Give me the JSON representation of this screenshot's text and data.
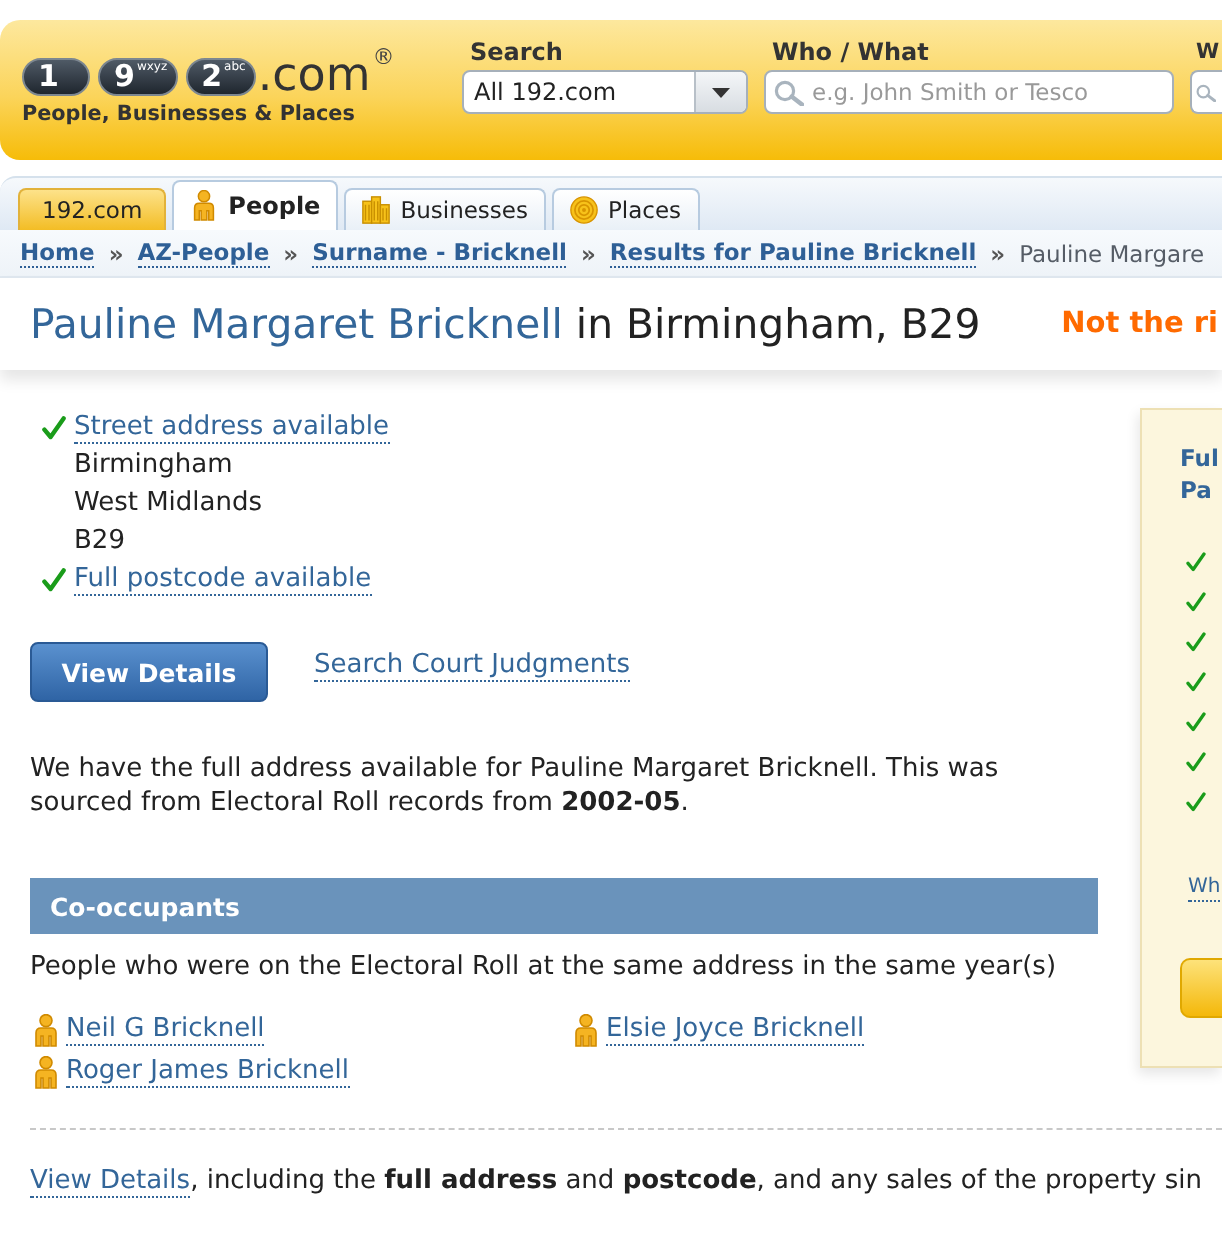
{
  "header": {
    "logo": {
      "keys": [
        {
          "digit": "1"
        },
        {
          "digit": "9",
          "letters": "wxyz"
        },
        {
          "digit": "2",
          "letters": "abc"
        }
      ],
      "domain": ".com",
      "registered": "®",
      "tagline": "People, Businesses & Places"
    },
    "search_fields": [
      {
        "kind": "select",
        "label": "Search",
        "value": "All 192.com"
      },
      {
        "kind": "text",
        "label": "Who / What",
        "placeholder": "e.g. John Smith or Tesco"
      },
      {
        "kind": "text",
        "label": "W"
      }
    ]
  },
  "tabs": [
    {
      "kind": "home",
      "label": "192.com",
      "selected": false
    },
    {
      "kind": "people",
      "label": "People",
      "selected": true
    },
    {
      "kind": "businesses",
      "label": "Businesses",
      "selected": false
    },
    {
      "kind": "places",
      "label": "Places",
      "selected": false
    }
  ],
  "breadcrumb": {
    "links": [
      {
        "label": "Home",
        "separator": "»"
      },
      {
        "label": "AZ-People",
        "separator": "»"
      },
      {
        "label": "Surname - Bricknell",
        "separator": "»"
      },
      {
        "label": "Results for Pauline Bricknell",
        "separator": "»"
      }
    ],
    "current": "Pauline Margare"
  },
  "title": {
    "name": "Pauline Margaret Bricknell",
    "location": "in Birmingham, B29",
    "notice": "Not the ri"
  },
  "address": [
    {
      "kind": "status",
      "text": "Street address available",
      "available": true
    },
    {
      "kind": "line",
      "text": "Birmingham"
    },
    {
      "kind": "line",
      "text": "West Midlands"
    },
    {
      "kind": "line",
      "text": "B29"
    },
    {
      "kind": "status",
      "text": "Full postcode available",
      "available": true
    }
  ],
  "actions": {
    "button": "View Details",
    "link": "Search Court Judgments"
  },
  "summary": "We have the full address available for Pauline Margaret Bricknell. This was sourced from Electoral Roll records from **2002-05**.",
  "co_occupants": {
    "heading": "Co-occupants",
    "intro": "People who were on the Electoral Roll at the same address in the same year(s)",
    "people": [
      "Neil G Bricknell",
      "Elsie Joyce Bricknell",
      "Roger James Bricknell"
    ]
  },
  "sidebar": {
    "heading_lines": [
      "Ful",
      "Pa"
    ],
    "features": [
      {
        "checked": true
      },
      {
        "checked": true
      },
      {
        "checked": true
      },
      {
        "checked": true
      },
      {
        "checked": true
      },
      {
        "checked": true
      },
      {
        "checked": true
      }
    ],
    "link": "Wh"
  },
  "footer": {
    "link": "View Details",
    "text": ", including the **full address** and **postcode**, and any sales of the property sin"
  }
}
